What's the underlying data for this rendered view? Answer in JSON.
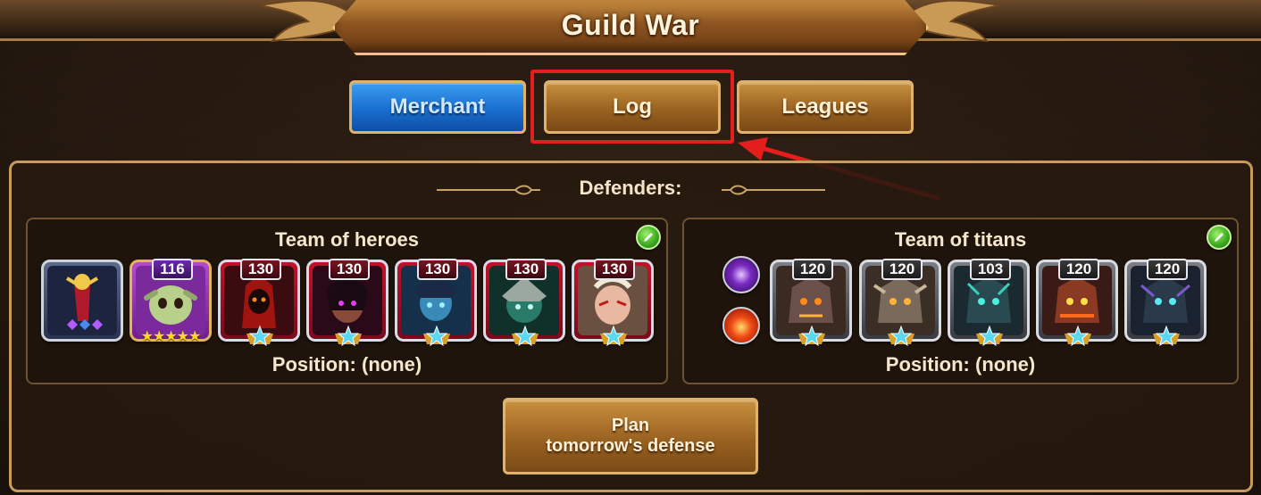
{
  "header": {
    "title": "Guild War"
  },
  "tabs": [
    {
      "label": "Merchant",
      "active": true
    },
    {
      "label": "Log",
      "highlighted": true
    },
    {
      "label": "Leagues"
    }
  ],
  "annotation": {
    "highlight_color": "#e41d1d"
  },
  "defenders": {
    "label": "Defenders:",
    "heroes": {
      "title": "Team of heroes",
      "position": "Position: (none)",
      "pet": {
        "icon": "pet-icon"
      },
      "units": [
        {
          "level": "116",
          "stars": "★★★★★",
          "frame": "purple"
        },
        {
          "level": "130",
          "frame": "red"
        },
        {
          "level": "130",
          "frame": "red"
        },
        {
          "level": "130",
          "frame": "red"
        },
        {
          "level": "130",
          "frame": "red"
        },
        {
          "level": "130",
          "frame": "red"
        }
      ]
    },
    "titans": {
      "title": "Team of titans",
      "position": "Position: (none)",
      "elements": [
        "dark-element-icon",
        "fire-element-icon"
      ],
      "units": [
        {
          "level": "120"
        },
        {
          "level": "120"
        },
        {
          "level": "103"
        },
        {
          "level": "120"
        },
        {
          "level": "120"
        }
      ]
    }
  },
  "actions": {
    "plan_line1": "Plan",
    "plan_line2": "tomorrow's defense"
  }
}
